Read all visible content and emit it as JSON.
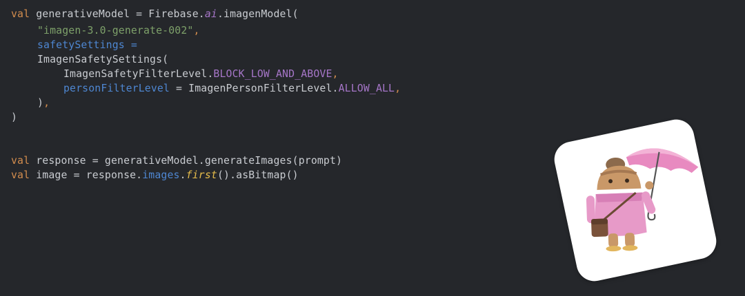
{
  "code": {
    "l1": {
      "kw": "val",
      "a": " generativeModel = Firebase.",
      "ai": "ai",
      "b": ".imagenModel("
    },
    "l2": {
      "str": "\"imagen-3.0-generate-002\"",
      "comma": ","
    },
    "l3": {
      "prop": "safetySettings",
      "eq": " ="
    },
    "l4": {
      "text": "ImagenSafetySettings("
    },
    "l5": {
      "a": "ImagenSafetyFilterLevel.",
      "const": "BLOCK_LOW_AND_ABOVE",
      "comma": ","
    },
    "l6": {
      "prop": "personFilterLevel",
      "a": " = ImagenPersonFilterLevel.",
      "const": "ALLOW_ALL",
      "comma": ","
    },
    "l7": {
      "paren": ")",
      "comma": ","
    },
    "l8": {
      "paren": ")"
    },
    "l9": {
      "kw": "val",
      "a": " response = generativeModel.generateImages(prompt)"
    },
    "l10": {
      "kw": "val",
      "a": " image = response.",
      "prop": "images",
      "dot": ".",
      "fn": "first",
      "b": "().asBitmap()"
    }
  },
  "colors": {
    "background": "#25272b",
    "keyword": "#d38d4e",
    "string": "#7ea16a",
    "property": "#4e87d2",
    "constant": "#a676c8",
    "function": "#e7bd4b",
    "plain": "#c9ccd1"
  },
  "image_card": {
    "subject": "android-robot-with-pink-umbrella"
  }
}
